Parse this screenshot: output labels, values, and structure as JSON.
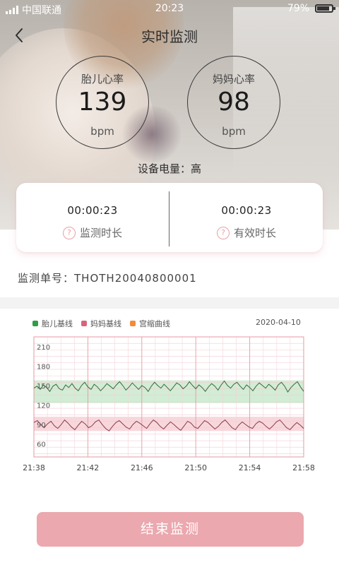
{
  "status_bar": {
    "carrier": "中国联通",
    "time": "20:23",
    "battery": "79%"
  },
  "nav": {
    "title": "实时监测"
  },
  "fetal": {
    "label": "胎儿心率",
    "value": "139",
    "unit": "bpm"
  },
  "mother": {
    "label": "妈妈心率",
    "value": "98",
    "unit": "bpm"
  },
  "device_battery": {
    "label": "设备电量：",
    "value": "高"
  },
  "monitor_time": {
    "value": "00:00:23",
    "label": "监测时长"
  },
  "effective_time": {
    "value": "00:00:23",
    "label": "有效时长"
  },
  "order": {
    "label": "监测单号：",
    "value": "THOTH20040800001"
  },
  "chart": {
    "legend": [
      {
        "label": "胎儿基线",
        "color": "#2f9e44"
      },
      {
        "label": "妈妈基线",
        "color": "#d9637a"
      },
      {
        "label": "宫缩曲线",
        "color": "#f08c3a"
      }
    ],
    "date": "2020-04-10"
  },
  "chart_data": {
    "type": "line",
    "x_ticks": [
      "21:38",
      "21:42",
      "21:46",
      "21:50",
      "21:54",
      "21:58"
    ],
    "y_ticks": [
      210,
      180,
      150,
      120,
      90,
      60
    ],
    "ylim": [
      40,
      225
    ],
    "xlim": [
      "21:38",
      "21:58"
    ],
    "bands": [
      {
        "name": "胎儿基线",
        "range": [
          123,
          158
        ],
        "color": "#d2ecd5"
      },
      {
        "name": "妈妈基线",
        "range": [
          80,
          102
        ],
        "color": "#f8d7dc"
      }
    ],
    "series": [
      {
        "name": "胎儿基线",
        "color": "#2f6e38",
        "values": [
          146,
          149,
          144,
          151,
          147,
          141,
          149,
          152,
          145,
          143,
          151,
          147,
          153,
          146,
          142,
          150,
          155,
          148,
          144,
          152,
          148,
          142,
          147,
          153,
          149,
          145,
          151,
          156,
          150,
          143,
          148,
          154,
          149,
          144,
          150,
          147,
          141,
          149,
          155,
          150,
          146,
          152,
          147,
          142,
          148,
          154,
          151,
          145,
          149,
          156,
          150,
          145,
          151,
          147,
          141,
          148,
          153,
          149,
          143,
          151,
          157,
          150,
          146,
          152,
          155,
          149,
          144,
          151,
          147,
          142,
          149,
          154,
          150,
          146,
          152,
          148,
          143,
          151,
          155,
          149,
          140,
          147,
          152,
          156,
          148,
          141
        ]
      },
      {
        "name": "妈妈基线",
        "color": "#8a3b48",
        "values": [
          93,
          96,
          90,
          85,
          91,
          95,
          88,
          84,
          90,
          97,
          92,
          86,
          82,
          89,
          95,
          91,
          85,
          88,
          94,
          97,
          90,
          84,
          80,
          87,
          93,
          96,
          91,
          86,
          83,
          90,
          95,
          92,
          88,
          84,
          91,
          97,
          93,
          87,
          83,
          89,
          94,
          90,
          85,
          81,
          88,
          95,
          92,
          86,
          84,
          90,
          96,
          93,
          88,
          83,
          87,
          93,
          97,
          91,
          85,
          82,
          89,
          94,
          90,
          86,
          84,
          91,
          95,
          92,
          87,
          83,
          88,
          94,
          97,
          91,
          85,
          82,
          88,
          93,
          89,
          84
        ]
      }
    ]
  },
  "end_button": {
    "label": "结束监测"
  }
}
